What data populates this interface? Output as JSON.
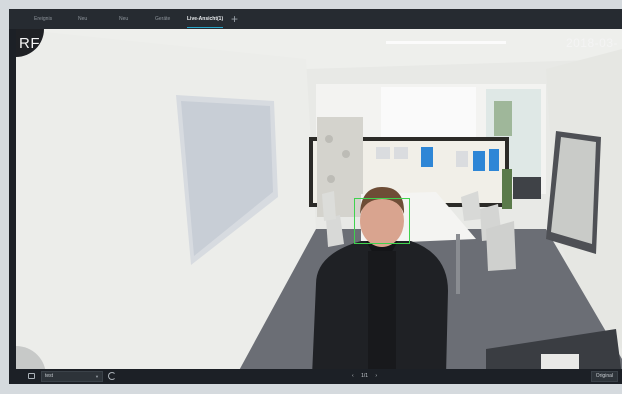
{
  "tabs": [
    {
      "label": "Ereignis",
      "active": false
    },
    {
      "label": "Neu",
      "active": false
    },
    {
      "label": "Neu",
      "active": false
    },
    {
      "label": "Geräte",
      "active": false
    },
    {
      "label": "Live-Ansicht(1)",
      "active": true
    }
  ],
  "add_tab_glyph": "+",
  "video": {
    "osd_left": "RF",
    "osd_timestamp": "2018-03-",
    "face_box_color": "#3fd24e"
  },
  "bottom_bar": {
    "stream_select_value": "test",
    "prev_glyph": "‹",
    "page_indicator": "1/1",
    "next_glyph": "›",
    "original_button_label": "Original"
  },
  "colors": {
    "accent": "#2aa7c9",
    "bar_bg": "#1c2026"
  },
  "icons": [
    "stream-icon",
    "refresh-icon",
    "plus-icon",
    "chevron-left-icon",
    "chevron-right-icon"
  ]
}
